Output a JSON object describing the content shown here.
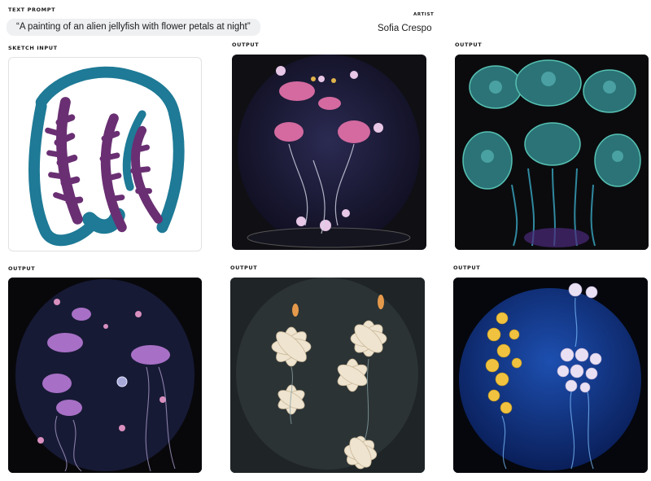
{
  "prompt": {
    "heading": "TEXT PROMPT",
    "text": "“A painting of an alien jellyfish with flower petals at night”"
  },
  "artist": {
    "heading": "ARTIST",
    "name": "Sofia Crespo"
  },
  "sketch": {
    "label": "SKETCH INPUT"
  },
  "outputs": [
    {
      "label": "OUTPUT"
    },
    {
      "label": "OUTPUT"
    },
    {
      "label": "OUTPUT"
    },
    {
      "label": "OUTPUT"
    },
    {
      "label": "OUTPUT"
    }
  ],
  "colors": {
    "sketch_teal": "#1e7a96",
    "sketch_purple": "#6a2f73",
    "prompt_bg": "#eef0f2"
  }
}
